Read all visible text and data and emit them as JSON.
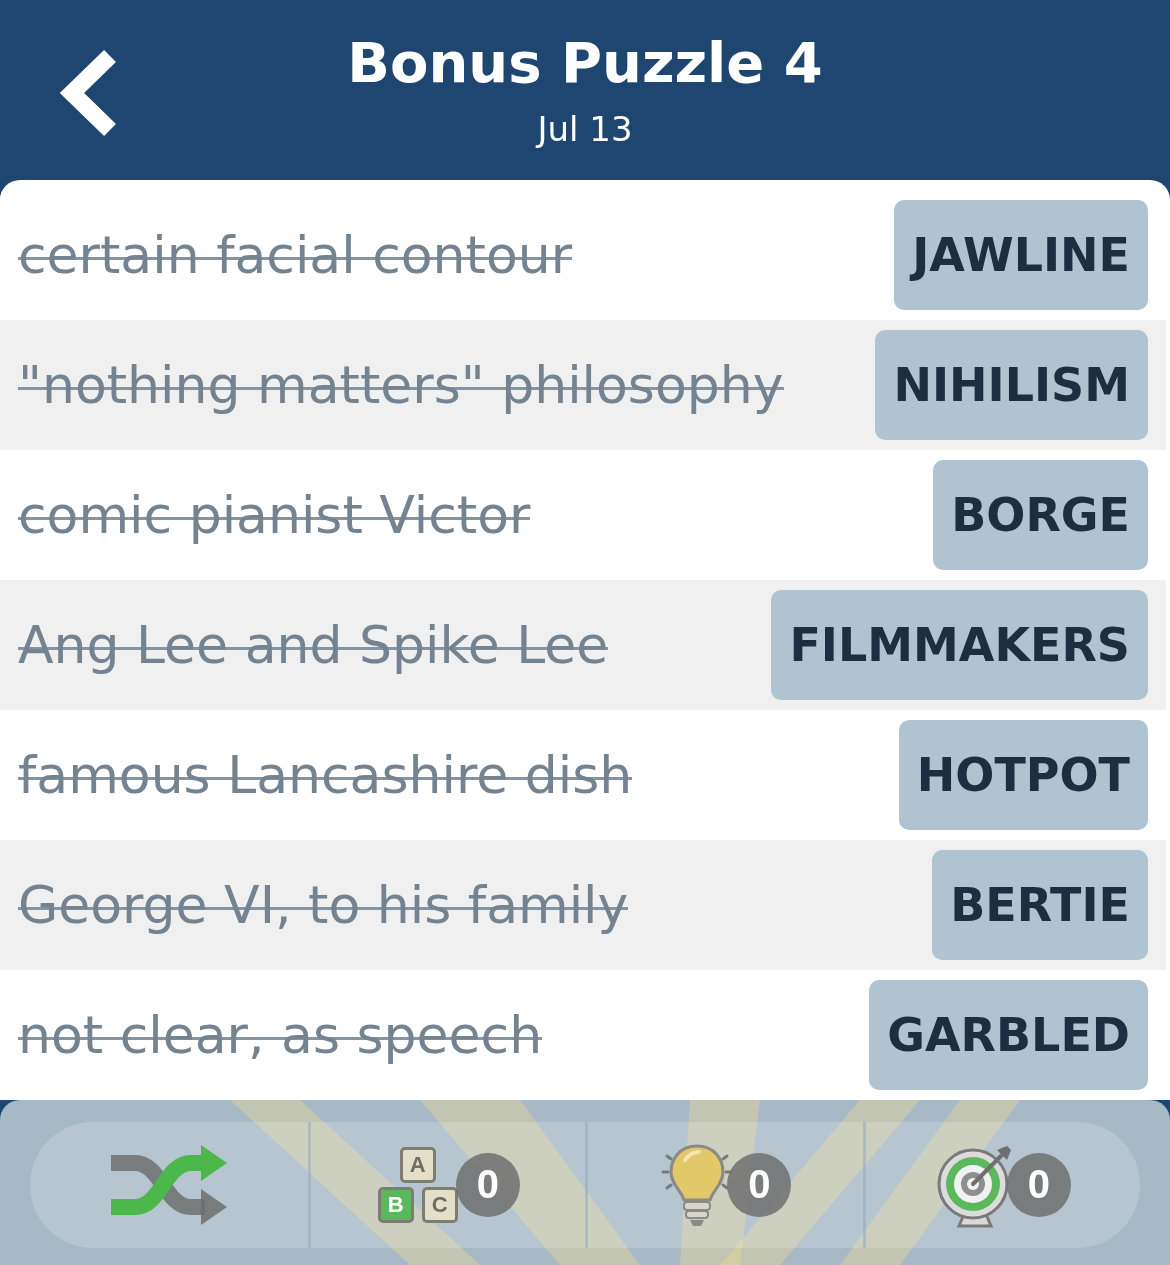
{
  "header": {
    "title": "Bonus Puzzle 4",
    "subtitle": "Jul 13"
  },
  "clues": [
    {
      "clue": "certain facial contour",
      "answer": "JAWLINE",
      "solved": true
    },
    {
      "clue": "\"nothing matters\" philosophy",
      "answer": "NIHILISM",
      "solved": true
    },
    {
      "clue": "comic pianist Victor",
      "answer": "BORGE",
      "solved": true
    },
    {
      "clue": "Ang Lee and Spike Lee",
      "answer": "FILMMAKERS",
      "solved": true
    },
    {
      "clue": "famous Lancashire dish",
      "answer": "HOTPOT",
      "solved": true
    },
    {
      "clue": "George VI, to his family",
      "answer": "BERTIE",
      "solved": true
    },
    {
      "clue": "not clear, as speech",
      "answer": "GARBLED",
      "solved": true
    }
  ],
  "toolbar": [
    {
      "kind": "shuffle"
    },
    {
      "kind": "letters",
      "blocks": [
        "A",
        "B",
        "C"
      ],
      "count": "0"
    },
    {
      "kind": "hint",
      "count": "0"
    },
    {
      "kind": "target",
      "count": "0"
    }
  ]
}
